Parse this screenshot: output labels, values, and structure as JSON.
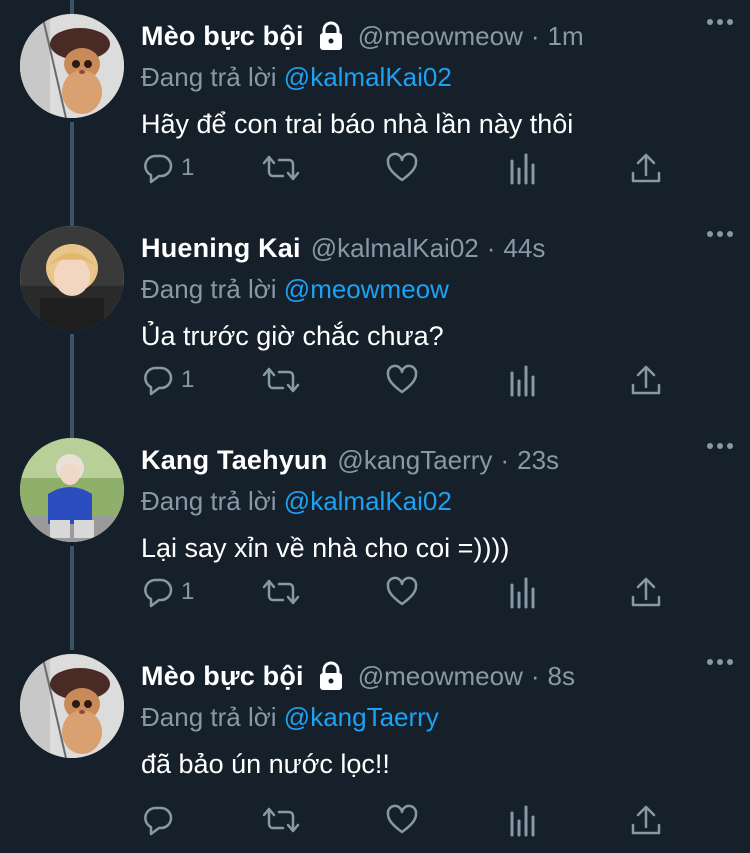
{
  "colors": {
    "background": "#15202b",
    "text": "#ffffff",
    "secondary": "#8899a6",
    "link": "#1da1f2",
    "thread_line": "#3d5466"
  },
  "reply_prefix": "Đang trả lời",
  "tweets": [
    {
      "name": "Mèo bực bội",
      "protected": true,
      "handle": "@meowmeow",
      "separator": "·",
      "time": "1m",
      "reply_to": "@kalmalKai02",
      "text": "Hãy để con trai báo nhà lần này thôi",
      "reply_count": "1",
      "avatar": "cat-avatar"
    },
    {
      "name": "Huening Kai",
      "protected": false,
      "handle": "@kalmalKai02",
      "separator": "·",
      "time": "44s",
      "reply_to": "@meowmeow",
      "text": "Ủa trước giờ chắc chưa?",
      "reply_count": "1",
      "avatar": "person-avatar"
    },
    {
      "name": "Kang Taehyun",
      "protected": false,
      "handle": "@kangTaerry",
      "separator": "·",
      "time": "23s",
      "reply_to": "@kalmalKai02",
      "text": "Lại say xỉn về nhà cho coi =))))",
      "reply_count": "1",
      "avatar": "person-avatar"
    },
    {
      "name": "Mèo bực bội",
      "protected": true,
      "handle": "@meowmeow",
      "separator": "·",
      "time": "8s",
      "reply_to": "@kangTaerry",
      "text": "đã bảo ún nước lọc!!",
      "reply_count": "",
      "avatar": "cat-avatar"
    }
  ],
  "icons": {
    "reply": "reply-icon",
    "retweet": "retweet-icon",
    "like": "heart-icon",
    "analytics": "analytics-icon",
    "share": "share-icon",
    "more": "more-icon",
    "lock": "lock-icon"
  }
}
